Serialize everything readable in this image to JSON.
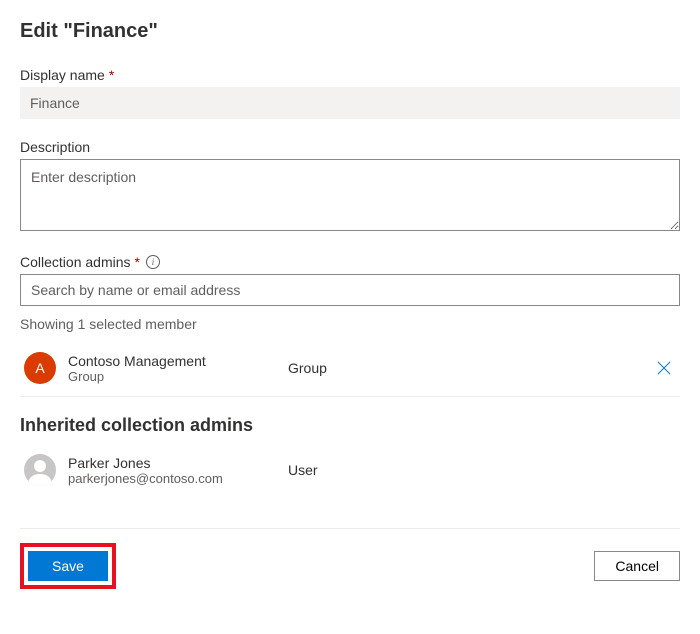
{
  "page": {
    "title": "Edit \"Finance\""
  },
  "fields": {
    "displayName": {
      "label": "Display name",
      "value": "Finance"
    },
    "description": {
      "label": "Description",
      "placeholder": "Enter description",
      "value": ""
    },
    "collectionAdmins": {
      "label": "Collection admins",
      "placeholder": "Search by name or email address",
      "statusText": "Showing 1 selected member"
    }
  },
  "members": [
    {
      "avatarInitial": "A",
      "name": "Contoso Management",
      "sub": "Group",
      "type": "Group"
    }
  ],
  "inherited": {
    "heading": "Inherited collection admins",
    "members": [
      {
        "name": "Parker Jones",
        "sub": "parkerjones@contoso.com",
        "type": "User"
      }
    ]
  },
  "footer": {
    "save": "Save",
    "cancel": "Cancel"
  }
}
